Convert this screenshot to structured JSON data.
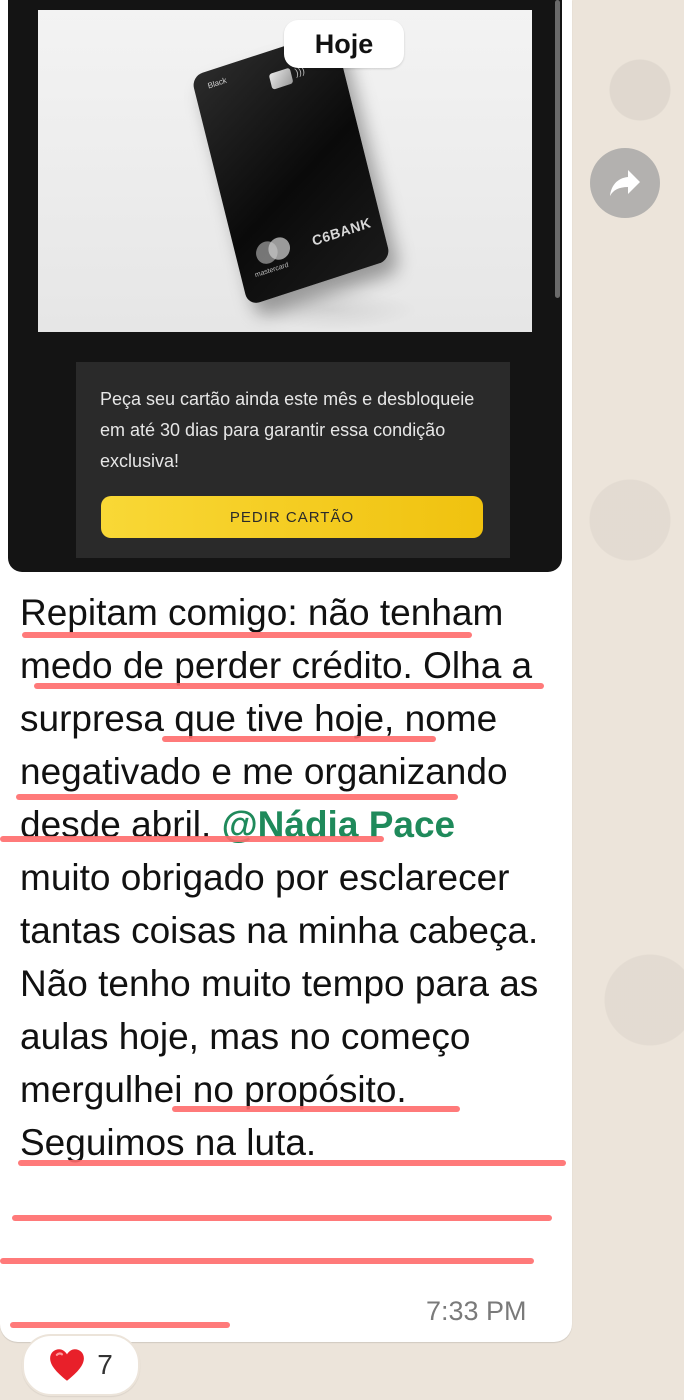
{
  "date_pill": "Hoje",
  "ad": {
    "card_label": "Black",
    "card_brand": "C6BANK",
    "card_network": "mastercard",
    "promo_text": "Peça seu cartão ainda este mês e desbloqueie em até 30 dias para garantir essa condição exclusiva!",
    "cta_label": "PEDIR CARTÃO"
  },
  "message": {
    "part1": "Repitam comigo: não tenham medo de perder crédito. Olha a surpresa que tive hoje, nome negativado e me organizando desde abril. ",
    "mention": "@Nádia Pace",
    "part2": " muito obrigado por esclarecer tantas coisas na minha cabeça. Não tenho muito tempo para as aulas hoje, mas no começo mergulhei no propósito. Seguimos na luta.",
    "time": "7:33 PM"
  },
  "reaction": {
    "emoji": "heart-icon",
    "count": "7"
  },
  "colors": {
    "mention": "#1f8a5b",
    "highlight": "#ff6b6b",
    "cta": "#f9d836"
  }
}
